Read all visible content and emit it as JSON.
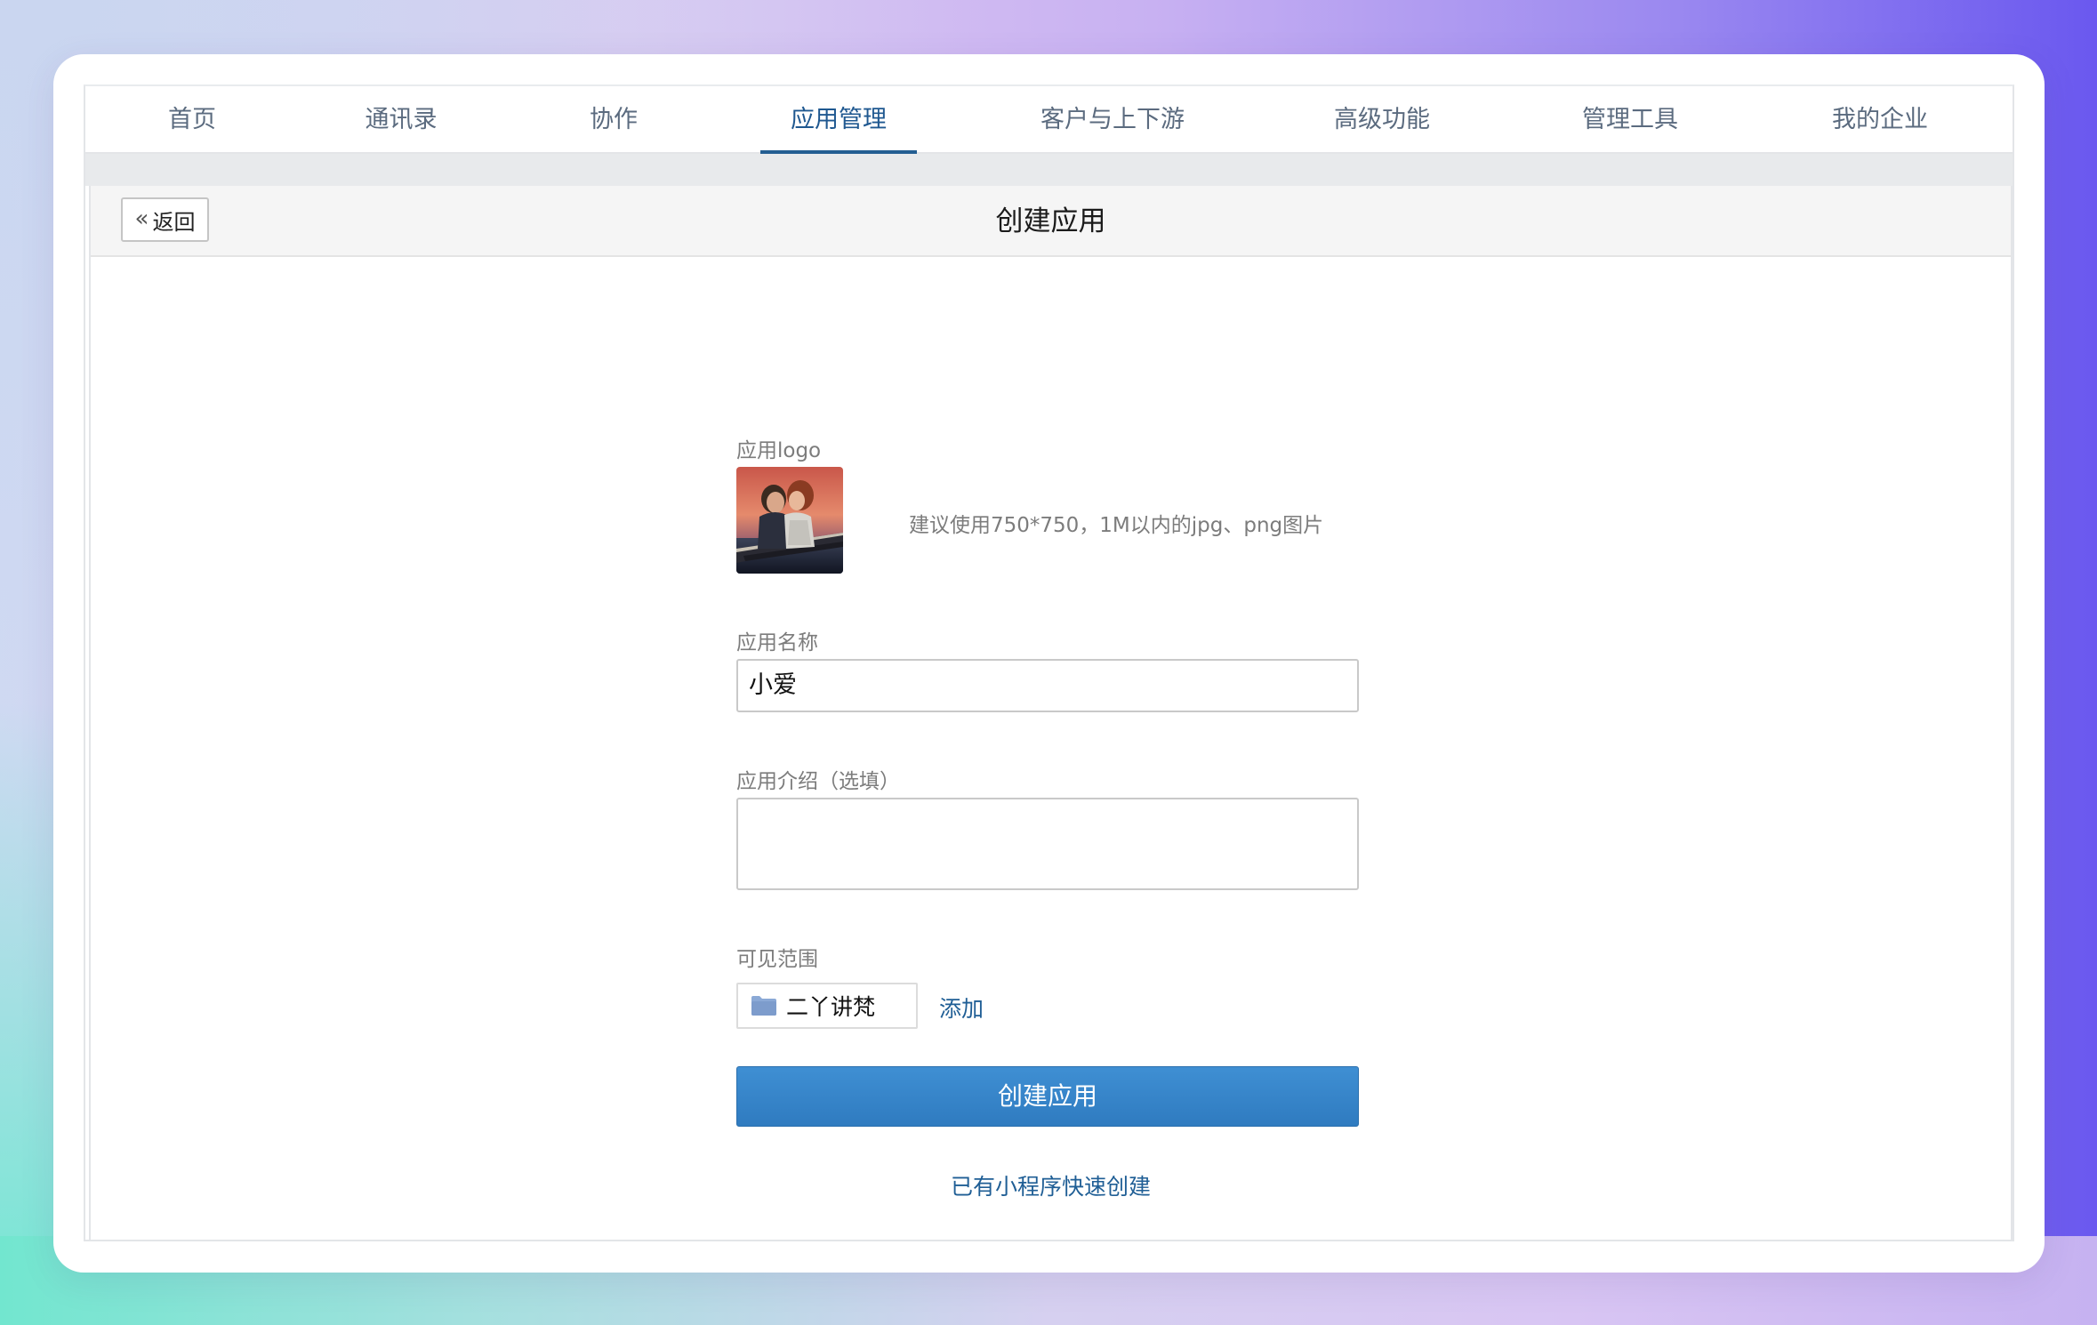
{
  "nav": {
    "items": [
      {
        "label": "首页",
        "active": false
      },
      {
        "label": "通讯录",
        "active": false
      },
      {
        "label": "协作",
        "active": false
      },
      {
        "label": "应用管理",
        "active": true
      },
      {
        "label": "客户与上下游",
        "active": false
      },
      {
        "label": "高级功能",
        "active": false
      },
      {
        "label": "管理工具",
        "active": false
      },
      {
        "label": "我的企业",
        "active": false
      }
    ]
  },
  "header": {
    "back_label": "返回",
    "back_icon": "double-chevron-left-icon",
    "title": "创建应用"
  },
  "form": {
    "logo_label": "应用logo",
    "logo_hint": "建议使用750*750，1M以内的jpg、png图片",
    "name_label": "应用名称",
    "name_value": "小爱",
    "desc_label": "应用介绍（选填）",
    "desc_value": "",
    "scope_label": "可见范围",
    "scope_tag": "二丫讲梵",
    "scope_icon": "folder-icon",
    "add_label": "添加",
    "submit_label": "创建应用",
    "miniapp_link": "已有小程序快速创建"
  },
  "colors": {
    "accent": "#2f7bc0",
    "link": "#1f5e95",
    "nav_active": "#1f5890",
    "folder": "#8ba9d6"
  }
}
